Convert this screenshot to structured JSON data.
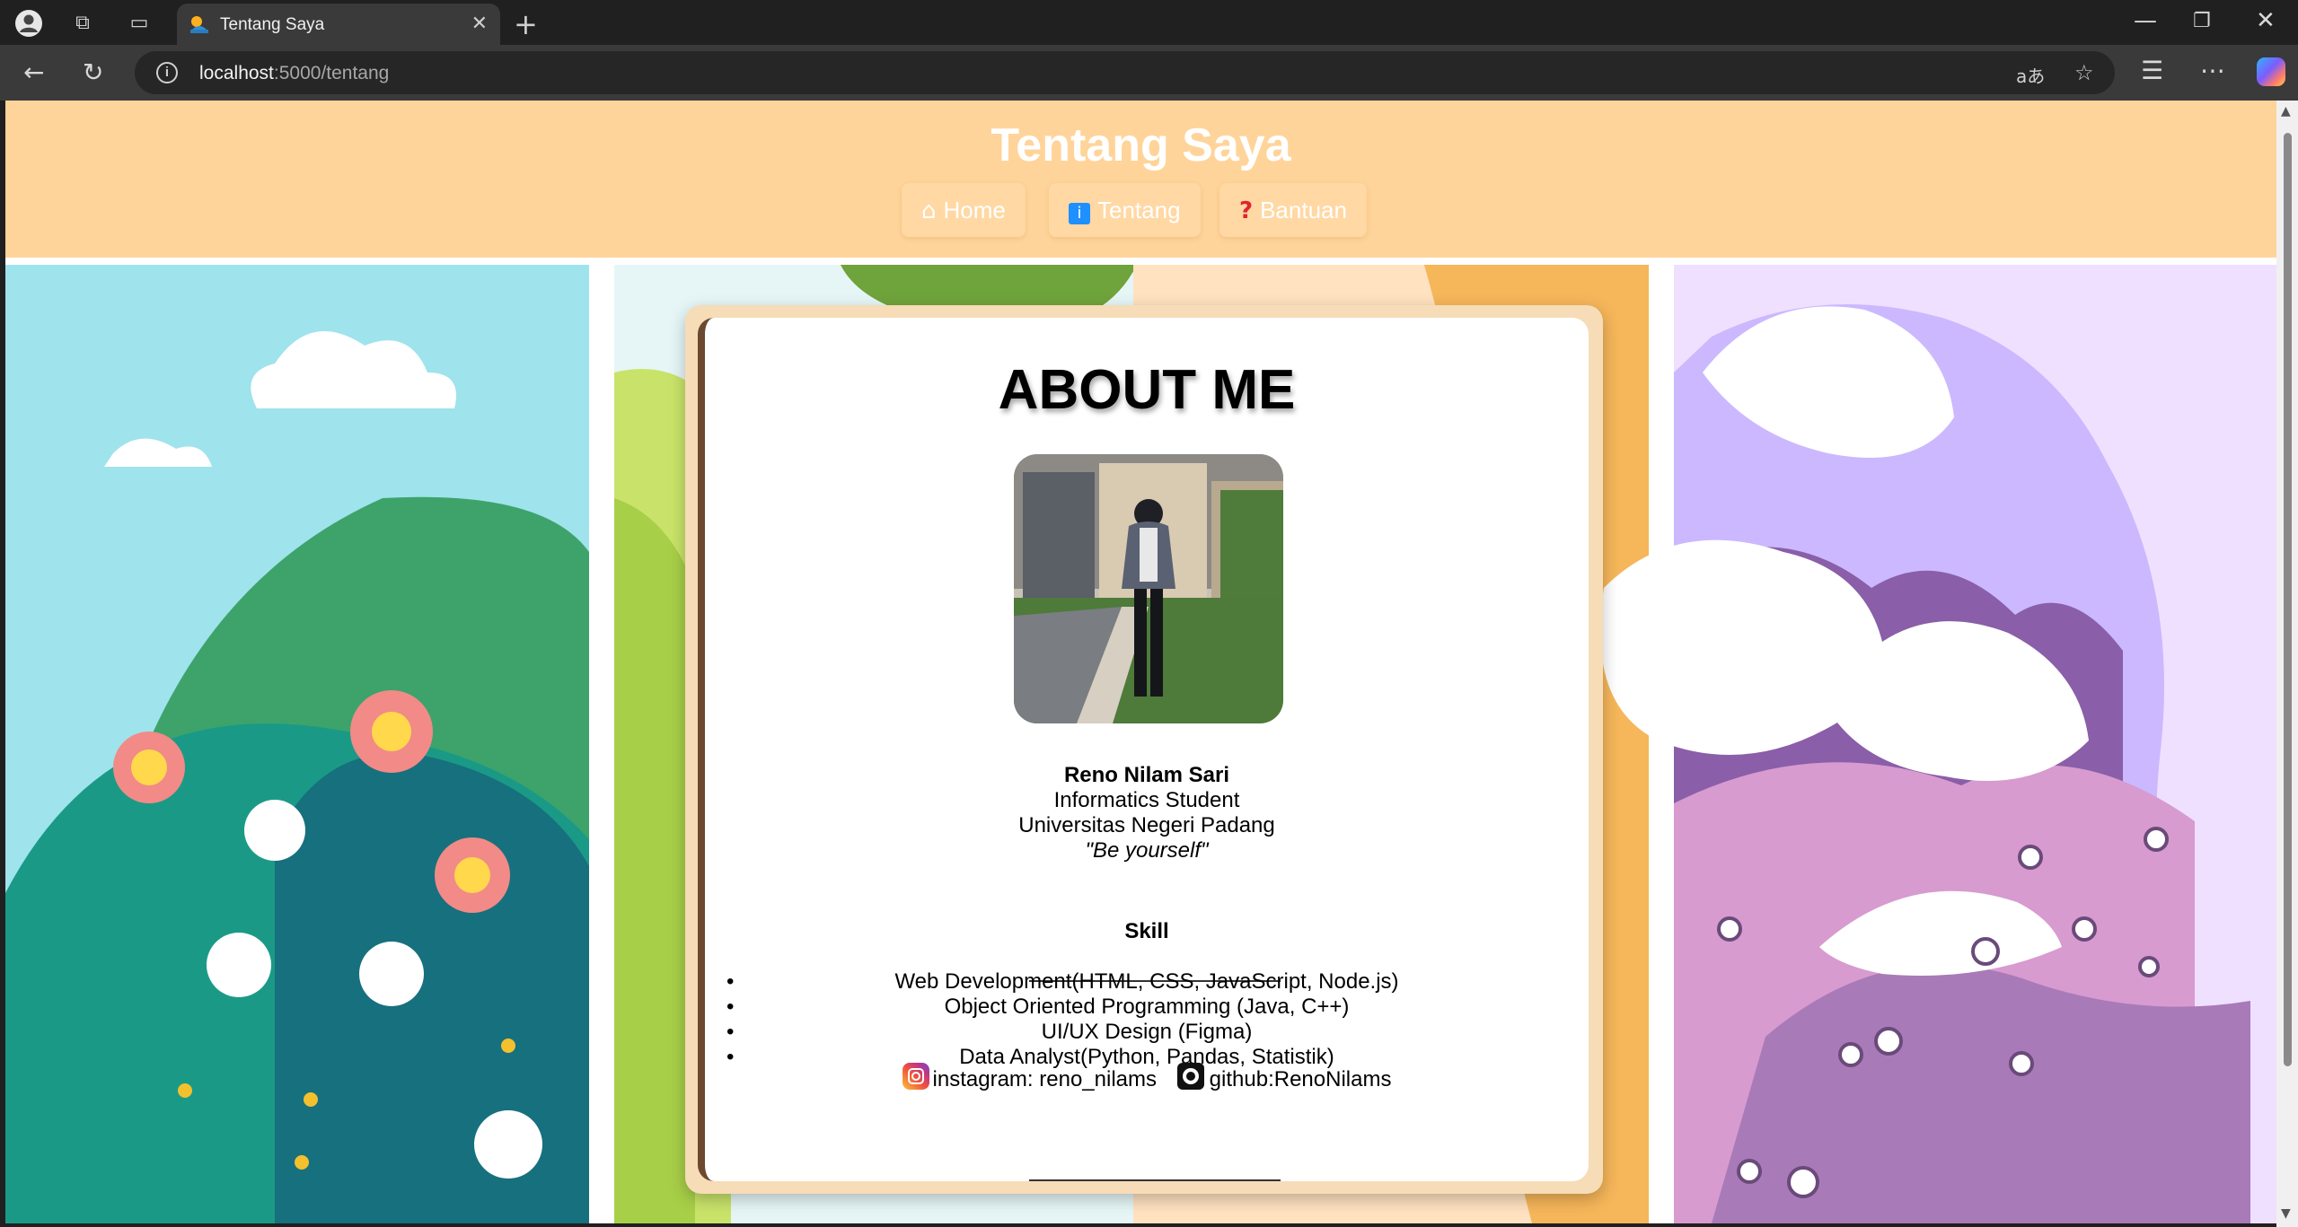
{
  "browser": {
    "tab_title": "Tentang Saya",
    "url_host": "localhost",
    "url_path": ":5000/tentang"
  },
  "header": {
    "title": "Tentang Saya",
    "nav": [
      {
        "label": "Home",
        "icon": "home-icon"
      },
      {
        "label": "Tentang",
        "icon": "info-icon"
      },
      {
        "label": "Bantuan",
        "icon": "question-icon"
      }
    ]
  },
  "card": {
    "heading": "ABOUT ME",
    "name": "Reno Nilam Sari",
    "role": "Informatics Student",
    "university": "Universitas Negeri Padang",
    "quote": "\"Be yourself\"",
    "skill_title": "Skill",
    "skills": [
      "Web Development(HTML, CSS, JavaScript, Node.js)",
      "Object Oriented Programming (Java, C++)",
      "UI/UX Design (Figma)",
      "Data Analyst(Python, Pandas, Statistik)"
    ],
    "instagram": "instagram: reno_nilams",
    "github": "github:RenoNilams"
  },
  "colors": {
    "header_bg": "#ffd49a",
    "card_border": "#6b4a2f"
  }
}
